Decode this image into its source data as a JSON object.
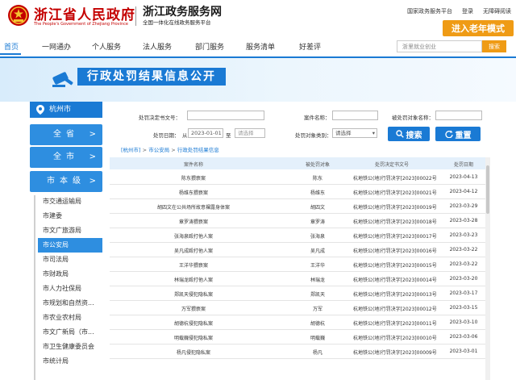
{
  "header": {
    "gov_name": "浙江省人民政府",
    "gov_name_en": "The People's Government of Zhejiang Province",
    "site_name": "浙江政务服务网",
    "site_sub": "全国一体化在线政务服务平台",
    "top_links": [
      "国家政务服务平台",
      "登录",
      "无障碍阅读"
    ],
    "elder_mode": "进入老年模式"
  },
  "nav": {
    "items": [
      "首页",
      "一网通办",
      "个人服务",
      "法人服务",
      "部门服务",
      "服务清单",
      "好差评"
    ],
    "active": 0,
    "search_placeholder": "浙里就业创业",
    "search_button": "搜索"
  },
  "banner": {
    "title": "行政处罚结果信息公开"
  },
  "sidebar": {
    "city": "杭州市",
    "level_buttons": [
      "全省",
      "全市",
      "市本级"
    ],
    "departments": [
      "市交通运输局",
      "市建委",
      "市文广旅游局",
      "市公安局",
      "市司法局",
      "市财政局",
      "市人力社保局",
      "市规划和自然资...",
      "市农业农村局",
      "市文广新局（市...",
      "市卫生健康委员会",
      "市统计局"
    ],
    "selected": 3
  },
  "filter": {
    "doc_no_label": "处罚决定书文号：",
    "case_name_label": "案件名称：",
    "target_name_label": "被处罚对象名称：",
    "date_label": "处罚日期：",
    "date_from_label": "从",
    "date_from": "2023-01-01",
    "date_to_label": "至",
    "date_to_placeholder": "请选择",
    "target_type_label": "处罚对象类别：",
    "target_type_value": "请选择",
    "search_btn": "搜索",
    "reset_btn": "重置"
  },
  "breadcrumb": {
    "city": "[杭州市]",
    "dept": "市公安局",
    "page": "行政处罚结果信息"
  },
  "table": {
    "headers": [
      "案件名称",
      "被处罚对象",
      "处罚决定书文号",
      "处罚日期"
    ],
    "rows": [
      [
        "陈东猥亵案",
        "陈东",
        "杭地铁公(地)行罚决字[2023]00022号",
        "2023-04-13"
      ],
      [
        "杨维东猥亵案",
        "杨维东",
        "杭地铁公(地)行罚决字[2023]00021号",
        "2023-04-12"
      ],
      [
        "胡四文在公共场所故意裸露身体案",
        "胡四文",
        "杭地铁公(地)行罚决字[2023]00019号",
        "2023-03-29"
      ],
      [
        "章罗涛猥亵案",
        "章罗涛",
        "杭地铁公(地)行罚决字[2023]00018号",
        "2023-03-28"
      ],
      [
        "张海泉殴打他人案",
        "张海泉",
        "杭地铁公(地)行罚决字[2023]00017号",
        "2023-03-23"
      ],
      [
        "吴凡成殴打他人案",
        "吴凡成",
        "杭地铁公(地)行罚决字[2023]00016号",
        "2023-03-22"
      ],
      [
        "王洋华猥亵案",
        "王洋华",
        "杭地铁公(地)行罚决字[2023]00015号",
        "2023-03-22"
      ],
      [
        "林瑞龙殴打他人案",
        "林瑞龙",
        "杭地铁公(地)行罚决字[2023]00014号",
        "2023-03-20"
      ],
      [
        "郑凯天侵犯隐私案",
        "郑凯天",
        "杭地铁公(地)行罚决字[2023]00013号",
        "2023-03-17"
      ],
      [
        "万军猥亵案",
        "万军",
        "杭地铁公(地)行罚决字[2023]00012号",
        "2023-03-15"
      ],
      [
        "胡德杭侵犯隐私案",
        "胡德杭",
        "杭地铁公(地)行罚决字[2023]00011号",
        "2023-03-10"
      ],
      [
        "明载巍侵犯隐私案",
        "明载巍",
        "杭地铁公(地)行罚决字[2023]00010号",
        "2023-03-06"
      ],
      [
        "杨凡侵犯隐私案",
        "杨凡",
        "杭地铁公(地)行罚决字[2023]00009号",
        "2023-03-01"
      ]
    ]
  },
  "colors": {
    "primary": "#1a7ad4",
    "accent": "#ef9b15",
    "brand_red": "#c40000"
  }
}
